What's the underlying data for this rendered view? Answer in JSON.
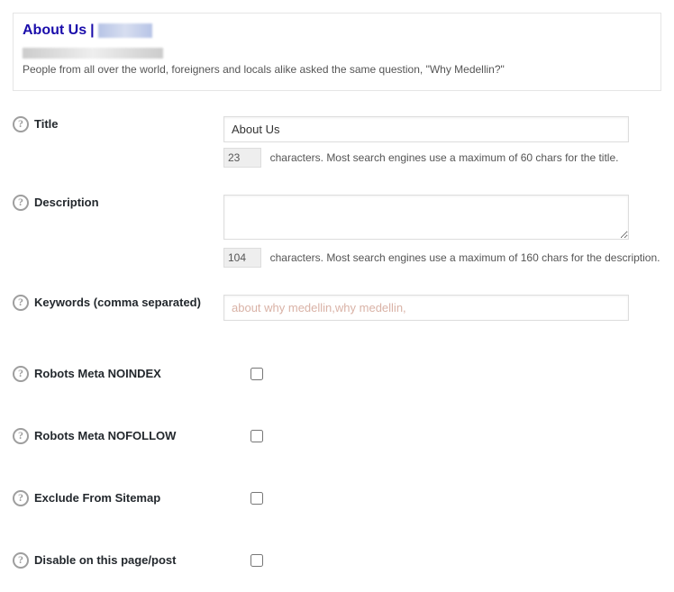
{
  "preview": {
    "title": "About Us",
    "separator": "|",
    "description": "People from all over the world, foreigners and locals alike asked the same question, \"Why Medellin?\""
  },
  "title": {
    "label": "Title",
    "value": "About Us",
    "count": "23",
    "hint": "characters. Most search engines use a maximum of 60 chars for the title."
  },
  "description": {
    "label": "Description",
    "value": "",
    "count": "104",
    "hint": "characters. Most search engines use a maximum of 160 chars for the description."
  },
  "keywords": {
    "label": "Keywords (comma separated)",
    "placeholder": "about why medellin,why medellin,"
  },
  "robots_noindex": {
    "label": "Robots Meta NOINDEX"
  },
  "robots_nofollow": {
    "label": "Robots Meta NOFOLLOW"
  },
  "exclude_sitemap": {
    "label": "Exclude From Sitemap"
  },
  "disable_page": {
    "label": "Disable on this page/post"
  }
}
